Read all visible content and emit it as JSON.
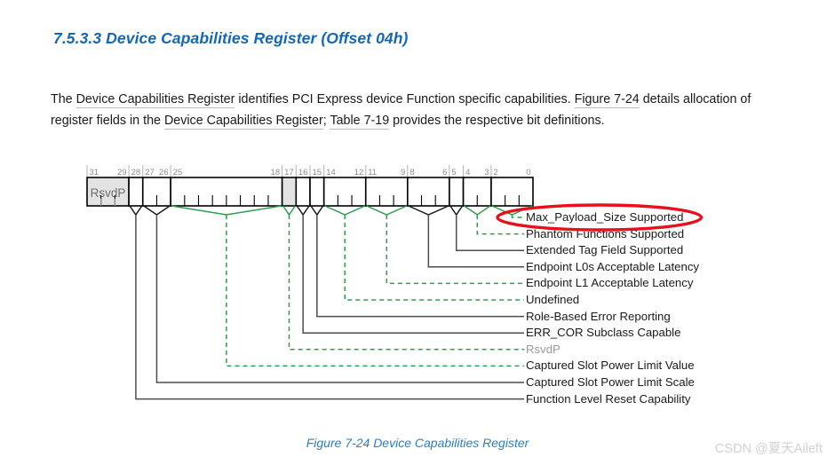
{
  "heading": "7.5.3.3 Device Capabilities Register (Offset 04h)",
  "paragraph": {
    "s1": "The ",
    "x1": "Device Capabilities Register",
    "s2": " identifies PCI Express device Function specific capabilities. ",
    "x2": "Figure  7-24",
    "s3": " details allocation of register fields in the ",
    "x3": "Device Capabilities Register",
    "s4": "; ",
    "x4": "Table  7-19",
    "s5": " provides the respective bit definitions."
  },
  "caption": "Figure  7-24  Device Capabilities Register",
  "watermark": "CSDN @夏天Aileft",
  "colors": {
    "heading": "#1667b1",
    "caption": "#2d7fc1",
    "green": "#2e9e4f",
    "black_leader": "#4d4d4d",
    "red": "#e8101b",
    "cell_fill": "#e3e3e3",
    "muted_text": "#9a9a9a"
  },
  "chart_data": {
    "type": "table",
    "title": "Device Capabilities Register",
    "register_offset": "04h",
    "bit_width": 32,
    "tick_labels": [
      "31",
      "29",
      "28",
      "27",
      "26",
      "25",
      "18",
      "17",
      "16",
      "15",
      "14",
      "12",
      "11",
      "9",
      "8",
      "6",
      "5",
      "4",
      "3",
      "2",
      "0"
    ],
    "fields": [
      {
        "name": "RsvdP",
        "bits": "31:29",
        "hi": 31,
        "lo": 29,
        "reserved": true,
        "leader": "none",
        "label_row": null
      },
      {
        "name": "Function Level Reset Capability",
        "bits": "28",
        "hi": 28,
        "lo": 28,
        "reserved": false,
        "leader": "black",
        "label_row": 11
      },
      {
        "name": "Captured Slot Power Limit Scale",
        "bits": "27:26",
        "hi": 27,
        "lo": 26,
        "reserved": false,
        "leader": "black",
        "label_row": 10
      },
      {
        "name": "Captured Slot Power Limit Value",
        "bits": "25:18",
        "hi": 25,
        "lo": 18,
        "reserved": false,
        "leader": "green",
        "label_row": 9
      },
      {
        "name": "RsvdP",
        "bits": "17",
        "hi": 17,
        "lo": 17,
        "reserved": true,
        "leader": "green",
        "label_row": 8
      },
      {
        "name": "ERR_COR Subclass Capable",
        "bits": "16",
        "hi": 16,
        "lo": 16,
        "reserved": false,
        "leader": "black",
        "label_row": 7
      },
      {
        "name": "Role-Based Error Reporting",
        "bits": "15",
        "hi": 15,
        "lo": 15,
        "reserved": false,
        "leader": "black",
        "label_row": 6
      },
      {
        "name": "Undefined",
        "bits": "14:12",
        "hi": 14,
        "lo": 12,
        "reserved": false,
        "leader": "green",
        "label_row": 5
      },
      {
        "name": "Endpoint L1 Acceptable Latency",
        "bits": "11:9",
        "hi": 11,
        "lo": 9,
        "reserved": false,
        "leader": "green",
        "label_row": 4
      },
      {
        "name": "Endpoint L0s Acceptable Latency",
        "bits": "8:6",
        "hi": 8,
        "lo": 6,
        "reserved": false,
        "leader": "black",
        "label_row": 3
      },
      {
        "name": "Extended Tag Field Supported",
        "bits": "5",
        "hi": 5,
        "lo": 5,
        "reserved": false,
        "leader": "black",
        "label_row": 2
      },
      {
        "name": "Phantom Functions Supported",
        "bits": "4:3",
        "hi": 4,
        "lo": 3,
        "reserved": false,
        "leader": "green",
        "label_row": 1
      },
      {
        "name": "Max_Payload_Size Supported",
        "bits": "2:0",
        "hi": 2,
        "lo": 0,
        "reserved": false,
        "leader": "green",
        "label_row": 0,
        "highlighted": true
      }
    ],
    "labels": [
      {
        "text": "Max_Payload_Size Supported",
        "leader": "green",
        "muted": false,
        "circled": true
      },
      {
        "text": "Phantom Functions Supported",
        "leader": "green",
        "muted": false,
        "circled": false
      },
      {
        "text": "Extended Tag Field Supported",
        "leader": "black",
        "muted": false,
        "circled": false
      },
      {
        "text": "Endpoint L0s Acceptable Latency",
        "leader": "black",
        "muted": false,
        "circled": false
      },
      {
        "text": "Endpoint L1 Acceptable Latency",
        "leader": "green",
        "muted": false,
        "circled": false
      },
      {
        "text": "Undefined",
        "leader": "green",
        "muted": false,
        "circled": false
      },
      {
        "text": "Role-Based Error Reporting",
        "leader": "black",
        "muted": false,
        "circled": false
      },
      {
        "text": "ERR_COR Subclass Capable",
        "leader": "black",
        "muted": false,
        "circled": false
      },
      {
        "text": "RsvdP",
        "leader": "green",
        "muted": true,
        "circled": false
      },
      {
        "text": "Captured Slot Power Limit Value",
        "leader": "green",
        "muted": false,
        "circled": false
      },
      {
        "text": "Captured Slot Power Limit Scale",
        "leader": "black",
        "muted": false,
        "circled": false
      },
      {
        "text": "Function Level Reset Capability",
        "leader": "black",
        "muted": false,
        "circled": false
      }
    ],
    "cells": [
      {
        "text": "RsvdP",
        "bits": "31:29",
        "filled": true
      },
      {
        "text": "",
        "bits": "28",
        "filled": false
      },
      {
        "text": "",
        "bits": "27:26",
        "filled": false
      },
      {
        "text": "",
        "bits": "25:18",
        "filled": false
      },
      {
        "text": "",
        "bits": "17",
        "filled": true
      },
      {
        "text": "",
        "bits": "16",
        "filled": false
      },
      {
        "text": "",
        "bits": "15",
        "filled": false
      },
      {
        "text": "",
        "bits": "14:12",
        "filled": false
      },
      {
        "text": "",
        "bits": "11:9",
        "filled": false
      },
      {
        "text": "",
        "bits": "8:6",
        "filled": false
      },
      {
        "text": "",
        "bits": "5",
        "filled": false
      },
      {
        "text": "",
        "bits": "4:3",
        "filled": false
      },
      {
        "text": "",
        "bits": "2:0",
        "filled": false
      }
    ]
  }
}
